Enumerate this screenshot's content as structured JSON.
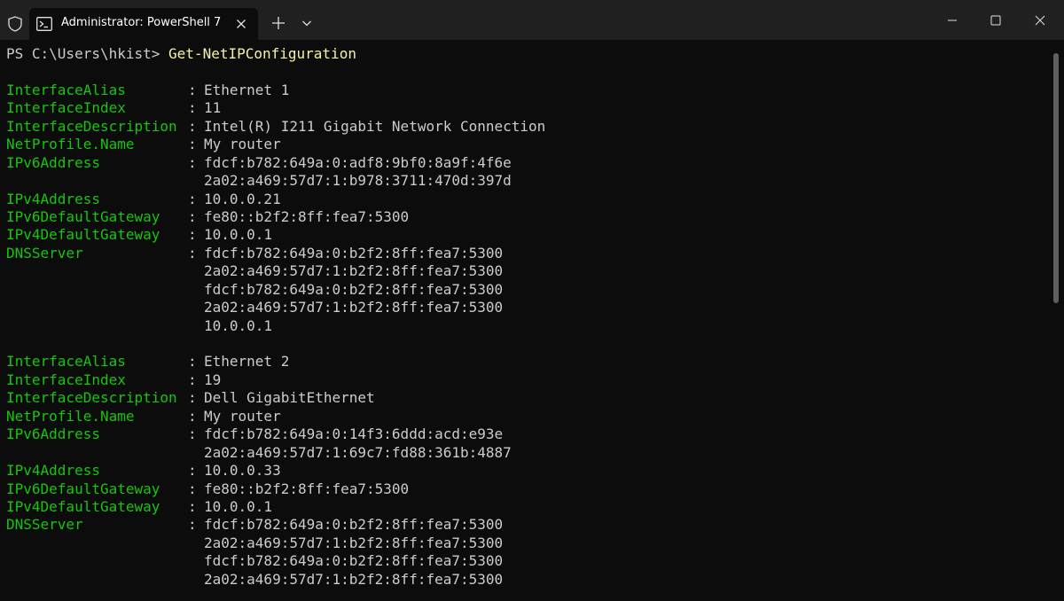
{
  "window": {
    "tab_title": "Administrator: PowerShell 7"
  },
  "icons": {
    "shield": "shield-icon",
    "terminal": "powershell-icon",
    "tab_close": "close-icon",
    "new_tab": "plus-icon",
    "dropdown": "chevron-down-icon",
    "minimize": "minimize-icon",
    "maximize": "maximize-icon",
    "close": "close-icon"
  },
  "colors": {
    "background": "#0c0c0c",
    "titlebar": "#202020",
    "property": "#16c60c",
    "command": "#f9f1a5",
    "text": "#cccccc"
  },
  "terminal": {
    "prompt": "PS C:\\Users\\hkist> ",
    "command": "Get-NetIPConfiguration",
    "separator": ":",
    "adapters": [
      {
        "interface_alias_key": "InterfaceAlias",
        "interface_alias": "Ethernet 1",
        "interface_index_key": "InterfaceIndex",
        "interface_index": "11",
        "interface_description_key": "InterfaceDescription",
        "interface_description": "Intel(R) I211 Gigabit Network Connection",
        "netprofile_name_key": "NetProfile.Name",
        "netprofile_name": "My router",
        "ipv6_address_key": "IPv6Address",
        "ipv6_address_1": "fdcf:b782:649a:0:adf8:9bf0:8a9f:4f6e",
        "ipv6_address_2": "2a02:a469:57d7:1:b978:3711:470d:397d",
        "ipv4_address_key": "IPv4Address",
        "ipv4_address": "10.0.0.21",
        "ipv6_gateway_key": "IPv6DefaultGateway",
        "ipv6_gateway": "fe80::b2f2:8ff:fea7:5300",
        "ipv4_gateway_key": "IPv4DefaultGateway",
        "ipv4_gateway": "10.0.0.1",
        "dns_key": "DNSServer",
        "dns_1": "fdcf:b782:649a:0:b2f2:8ff:fea7:5300",
        "dns_2": "2a02:a469:57d7:1:b2f2:8ff:fea7:5300",
        "dns_3": "fdcf:b782:649a:0:b2f2:8ff:fea7:5300",
        "dns_4": "2a02:a469:57d7:1:b2f2:8ff:fea7:5300",
        "dns_5": "10.0.0.1"
      },
      {
        "interface_alias_key": "InterfaceAlias",
        "interface_alias": "Ethernet 2",
        "interface_index_key": "InterfaceIndex",
        "interface_index": "19",
        "interface_description_key": "InterfaceDescription",
        "interface_description": "Dell GigabitEthernet",
        "netprofile_name_key": "NetProfile.Name",
        "netprofile_name": "My router",
        "ipv6_address_key": "IPv6Address",
        "ipv6_address_1": "fdcf:b782:649a:0:14f3:6ddd:acd:e93e",
        "ipv6_address_2": "2a02:a469:57d7:1:69c7:fd88:361b:4887",
        "ipv4_address_key": "IPv4Address",
        "ipv4_address": "10.0.0.33",
        "ipv6_gateway_key": "IPv6DefaultGateway",
        "ipv6_gateway": "fe80::b2f2:8ff:fea7:5300",
        "ipv4_gateway_key": "IPv4DefaultGateway",
        "ipv4_gateway": "10.0.0.1",
        "dns_key": "DNSServer",
        "dns_1": "fdcf:b782:649a:0:b2f2:8ff:fea7:5300",
        "dns_2": "2a02:a469:57d7:1:b2f2:8ff:fea7:5300",
        "dns_3": "fdcf:b782:649a:0:b2f2:8ff:fea7:5300",
        "dns_4": "2a02:a469:57d7:1:b2f2:8ff:fea7:5300"
      }
    ]
  }
}
